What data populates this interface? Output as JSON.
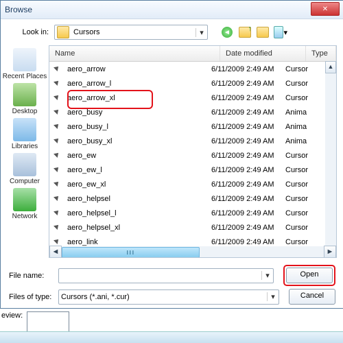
{
  "title": "Browse",
  "lookin_label": "Look in:",
  "lookin_value": "Cursors",
  "sidebar": [
    {
      "label": "Recent Places",
      "icon": "ico-recent"
    },
    {
      "label": "Desktop",
      "icon": "ico-desktop"
    },
    {
      "label": "Libraries",
      "icon": "ico-lib"
    },
    {
      "label": "Computer",
      "icon": "ico-comp"
    },
    {
      "label": "Network",
      "icon": "ico-net"
    }
  ],
  "columns": {
    "name": "Name",
    "date": "Date modified",
    "type": "Type"
  },
  "files": [
    {
      "name": "aero_arrow",
      "date": "6/11/2009 2:49 AM",
      "type": "Cursor"
    },
    {
      "name": "aero_arrow_l",
      "date": "6/11/2009 2:49 AM",
      "type": "Cursor"
    },
    {
      "name": "aero_arrow_xl",
      "date": "6/11/2009 2:49 AM",
      "type": "Cursor"
    },
    {
      "name": "aero_busy",
      "date": "6/11/2009 2:49 AM",
      "type": "Anima"
    },
    {
      "name": "aero_busy_l",
      "date": "6/11/2009 2:49 AM",
      "type": "Anima"
    },
    {
      "name": "aero_busy_xl",
      "date": "6/11/2009 2:49 AM",
      "type": "Anima"
    },
    {
      "name": "aero_ew",
      "date": "6/11/2009 2:49 AM",
      "type": "Cursor"
    },
    {
      "name": "aero_ew_l",
      "date": "6/11/2009 2:49 AM",
      "type": "Cursor"
    },
    {
      "name": "aero_ew_xl",
      "date": "6/11/2009 2:49 AM",
      "type": "Cursor"
    },
    {
      "name": "aero_helpsel",
      "date": "6/11/2009 2:49 AM",
      "type": "Cursor"
    },
    {
      "name": "aero_helpsel_l",
      "date": "6/11/2009 2:49 AM",
      "type": "Cursor"
    },
    {
      "name": "aero_helpsel_xl",
      "date": "6/11/2009 2:49 AM",
      "type": "Cursor"
    },
    {
      "name": "aero_link",
      "date": "6/11/2009 2:49 AM",
      "type": "Cursor"
    }
  ],
  "filename_label": "File name:",
  "filename_value": "",
  "filetype_label": "Files of type:",
  "filetype_value": "Cursors (*.ani, *.cur)",
  "open": "Open",
  "cancel": "Cancel",
  "preview_label": "eview:"
}
